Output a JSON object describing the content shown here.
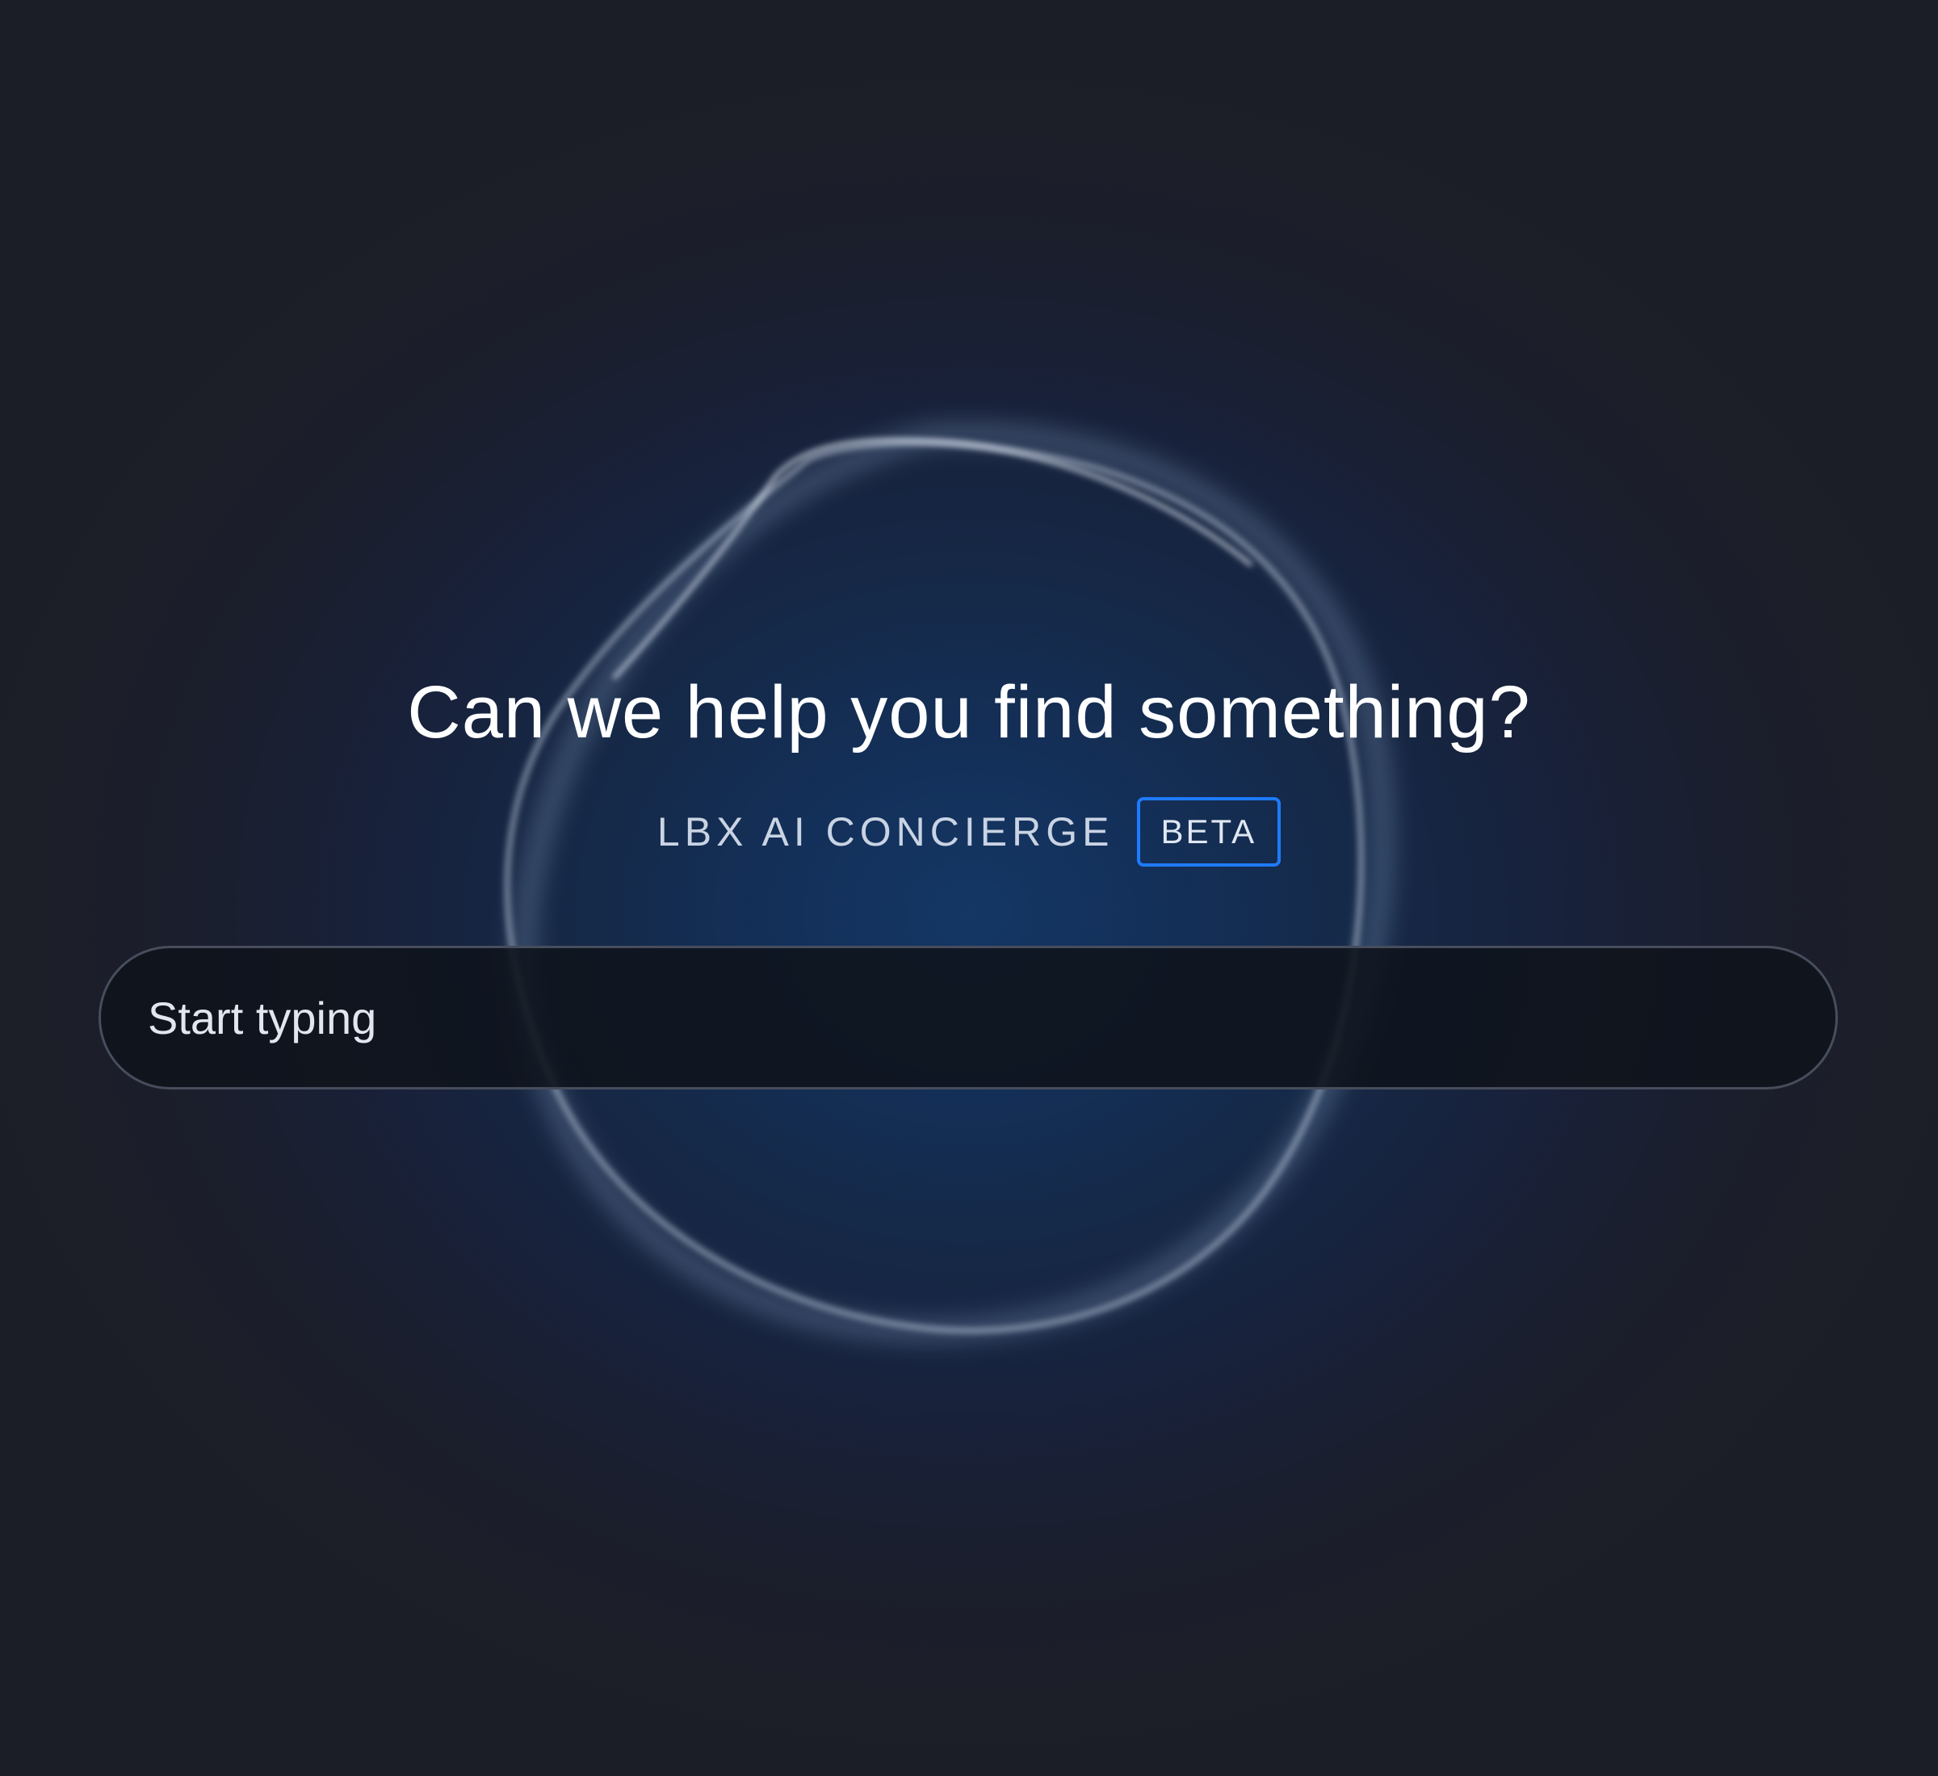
{
  "hero": {
    "headline": "Can we help you find something?"
  },
  "brand": {
    "label": "LBX AI CONCIERGE",
    "badge": "BETA"
  },
  "search": {
    "placeholder": "Start typing",
    "value": ""
  },
  "colors": {
    "background": "#1c1e27",
    "glow": "#143764",
    "accent": "#1e7bff",
    "text": "#ffffff",
    "subtext": "#c9d3e3",
    "input_bg": "#0f131b",
    "input_border": "#474d5c"
  }
}
